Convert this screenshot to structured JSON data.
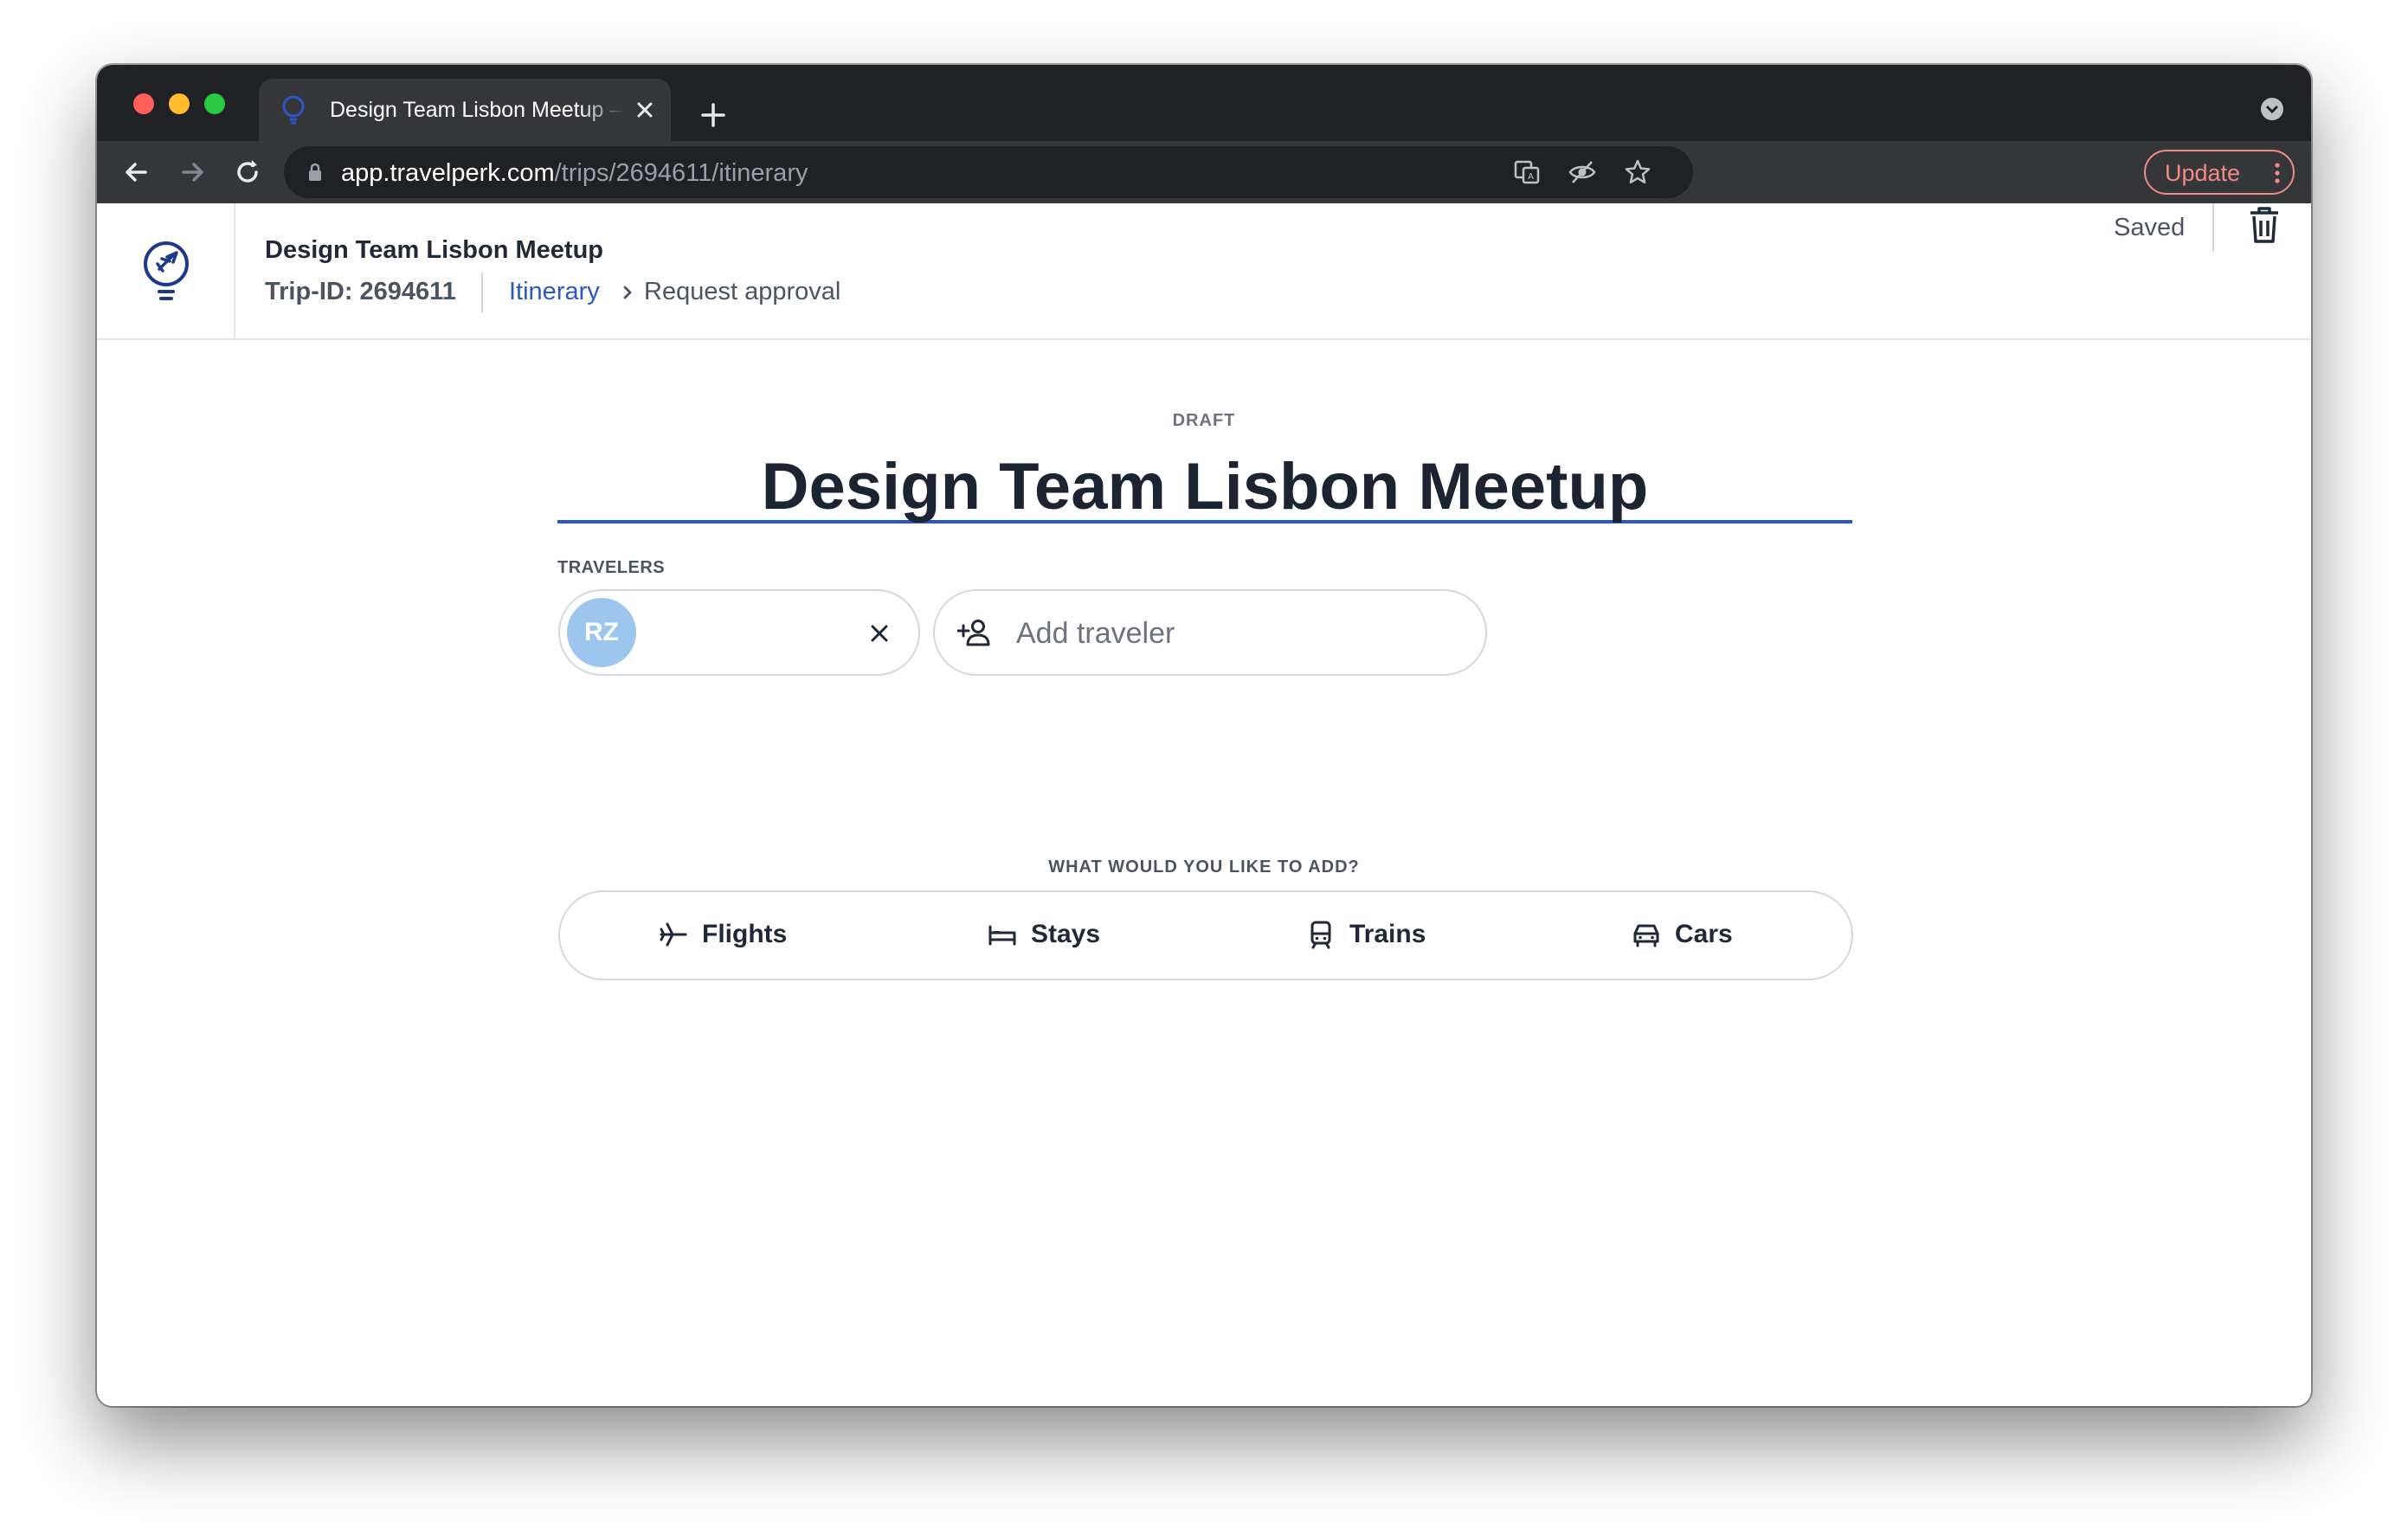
{
  "browser": {
    "tab": {
      "title": "Design Team Lisbon Meetup — TravelPerk"
    },
    "address_bar": {
      "host": "app.travelperk.com",
      "path": "/trips/2694611/itinerary"
    },
    "update_button": {
      "label": "Update"
    }
  },
  "header": {
    "trip_name": "Design Team Lisbon Meetup",
    "trip_id": "Trip-ID: 2694611",
    "breadcrumb": {
      "current": "Itinerary",
      "next": "Request approval"
    },
    "save_status": "Saved"
  },
  "main": {
    "status_label": "DRAFT",
    "trip_title": "Design Team Lisbon Meetup",
    "travelers": {
      "label": "TRAVELERS",
      "items": [
        {
          "initials": "RZ"
        }
      ],
      "add_placeholder": "Add traveler"
    },
    "add_section": {
      "label": "WHAT WOULD YOU LIKE TO ADD?",
      "options": [
        {
          "label": "Flights",
          "icon": "airplane-icon"
        },
        {
          "label": "Stays",
          "icon": "bed-icon"
        },
        {
          "label": "Trains",
          "icon": "train-icon"
        },
        {
          "label": "Cars",
          "icon": "car-icon"
        }
      ]
    }
  },
  "colors": {
    "accent": "#2a57c7",
    "avatar": "#9dc6ee",
    "update": "#f28b82",
    "text_dark": "#1c2432"
  }
}
